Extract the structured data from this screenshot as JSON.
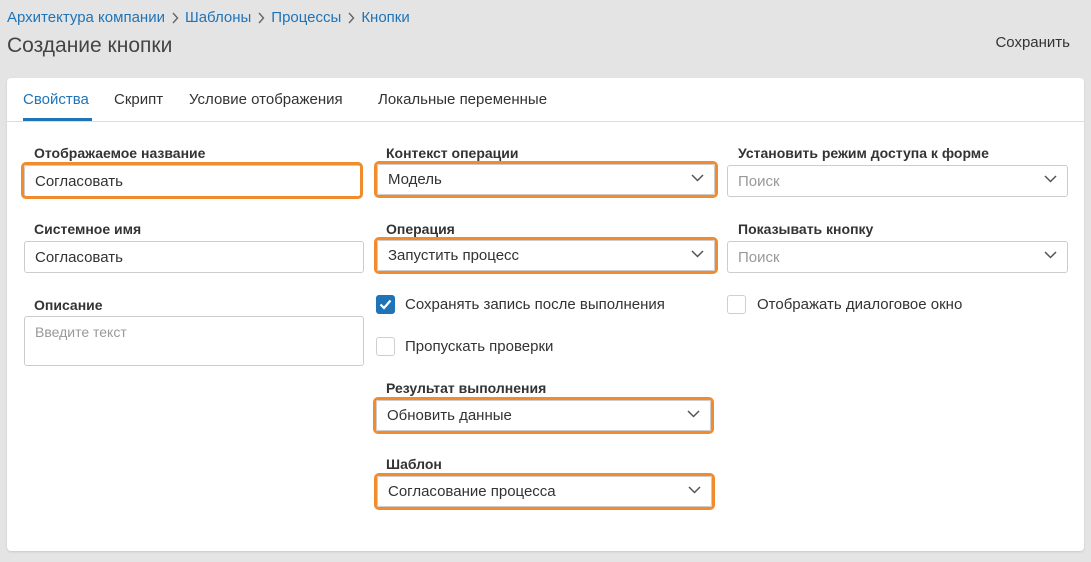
{
  "breadcrumb": [
    "Архитектура компании",
    "Шаблоны",
    "Процессы",
    "Кнопки"
  ],
  "page_title": "Создание кнопки",
  "save_label": "Сохранить",
  "tabs": [
    "Свойства",
    "Скрипт",
    "Условие отображения",
    "Локальные переменные"
  ],
  "active_tab": "Свойства",
  "form": {
    "display_name": {
      "label": "Отображаемое название",
      "value": "Согласовать"
    },
    "system_name": {
      "label": "Системное имя",
      "value": "Согласовать"
    },
    "description": {
      "label": "Описание",
      "placeholder": "Введите текст"
    },
    "operation_context": {
      "label": "Контекст операции",
      "value": "Модель"
    },
    "operation": {
      "label": "Операция",
      "value": "Запустить процесс"
    },
    "save_record": {
      "label": "Сохранять запись после выполнения",
      "checked": true
    },
    "skip_checks": {
      "label": "Пропускать проверки",
      "checked": false
    },
    "result": {
      "label": "Результат выполнения",
      "value": "Обновить данные"
    },
    "template": {
      "label": "Шаблон",
      "value": "Согласование процесса"
    },
    "form_access": {
      "label": "Установить режим доступа к форме",
      "placeholder": "Поиск"
    },
    "show_button": {
      "label": "Показывать кнопку",
      "placeholder": "Поиск"
    },
    "show_dialog": {
      "label": "Отображать диалоговое окно",
      "checked": false
    }
  },
  "colors": {
    "accent": "#1f74b8",
    "highlight": "#f08c2e",
    "background": "#e4e4e4"
  },
  "icons": {
    "breadcrumb_separator": "chevron-right-icon",
    "select_arrow": "chevron-down-icon",
    "checkbox_mark": "checkmark-icon"
  }
}
